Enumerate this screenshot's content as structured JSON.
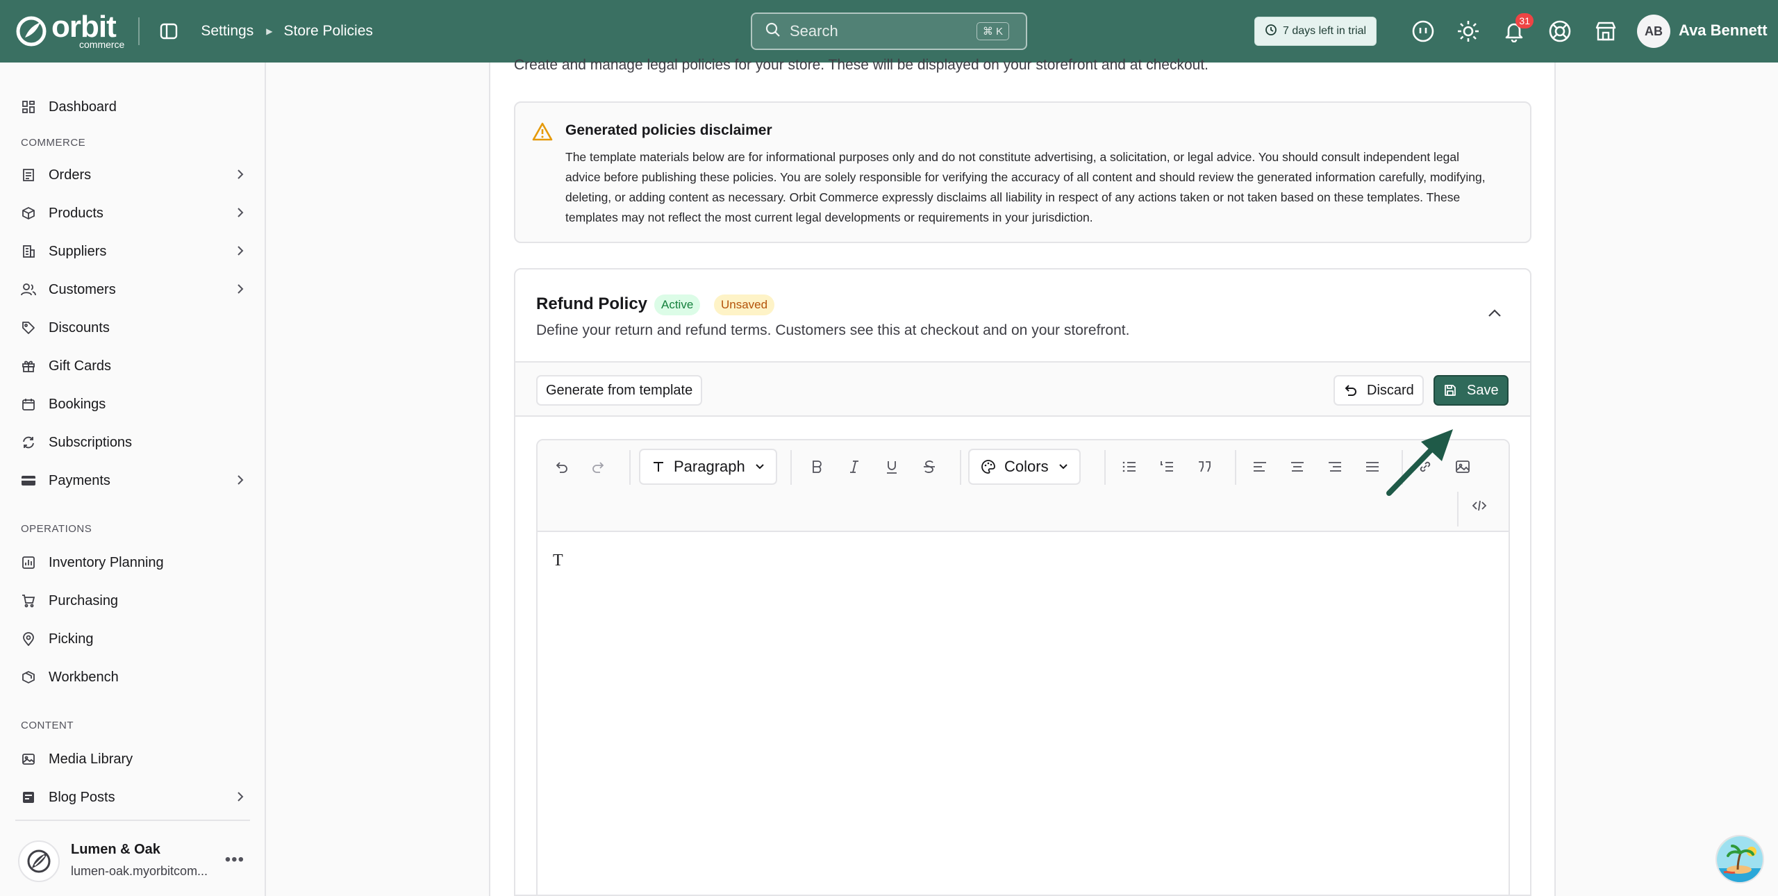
{
  "app": {
    "logo_word": "orbit",
    "logo_sub": "commerce"
  },
  "header": {
    "breadcrumb": [
      "Settings",
      "Store Policies"
    ],
    "search_placeholder": "Search",
    "search_shortcut": "⌘ K",
    "trial_text": "7 days left in trial",
    "notifications_count": "31",
    "user_initials": "AB",
    "user_name": "Ava Bennett"
  },
  "sidebar": {
    "items": [
      {
        "label": "Dashboard",
        "icon": "dashboard-icon"
      },
      {
        "label": "Orders",
        "icon": "orders-icon"
      },
      {
        "label": "Products",
        "icon": "box-icon"
      },
      {
        "label": "Suppliers",
        "icon": "building-icon"
      },
      {
        "label": "Customers",
        "icon": "users-icon"
      },
      {
        "label": "Discounts",
        "icon": "tag-icon"
      },
      {
        "label": "Gift Cards",
        "icon": "gift-icon"
      },
      {
        "label": "Bookings",
        "icon": "calendar-icon"
      },
      {
        "label": "Subscriptions",
        "icon": "refresh-icon"
      },
      {
        "label": "Payments",
        "icon": "card-icon"
      },
      {
        "label": "Inventory Planning",
        "icon": "chart-icon"
      },
      {
        "label": "Purchasing",
        "icon": "cart-icon"
      },
      {
        "label": "Picking",
        "icon": "pin-icon"
      },
      {
        "label": "Workbench",
        "icon": "cube-icon"
      },
      {
        "label": "Media Library",
        "icon": "image-icon"
      },
      {
        "label": "Blog Posts",
        "icon": "blog-icon"
      }
    ],
    "sections": [
      "COMMERCE",
      "OPERATIONS",
      "CONTENT"
    ],
    "store": {
      "name": "Lumen & Oak",
      "url": "lumen-oak.myorbitcom..."
    }
  },
  "main": {
    "subtitle": "Create and manage legal policies for your store. These will be displayed on your storefront and at checkout.",
    "disclaimer": {
      "title": "Generated policies disclaimer",
      "body": "The template materials below are for informational purposes only and do not constitute advertising, a solicitation, or legal advice. You should consult independent legal advice before publishing these policies. You are solely responsible for verifying the accuracy of all content and should review the generated information carefully, modifying, deleting, or adding content as necessary. Orbit Commerce expressly disclaims all liability in respect of any actions taken or not taken based on these templates. These templates may not reflect the most current legal developments or requirements in your jurisdiction."
    },
    "policy": {
      "title": "Refund Policy",
      "badge_active": "Active",
      "badge_unsaved": "Unsaved",
      "description": "Define your return and refund terms. Customers see this at checkout and on your storefront.",
      "generate_label": "Generate from template",
      "discard_label": "Discard",
      "save_label": "Save"
    },
    "editor": {
      "block_type": "Paragraph",
      "colors_label": "Colors",
      "content": "T"
    }
  },
  "colors": {
    "brand": "#3a7062",
    "save": "#2f6a5a",
    "active_badge": "#15803d",
    "unsaved_badge": "#b45309",
    "notification": "#ef4444"
  }
}
